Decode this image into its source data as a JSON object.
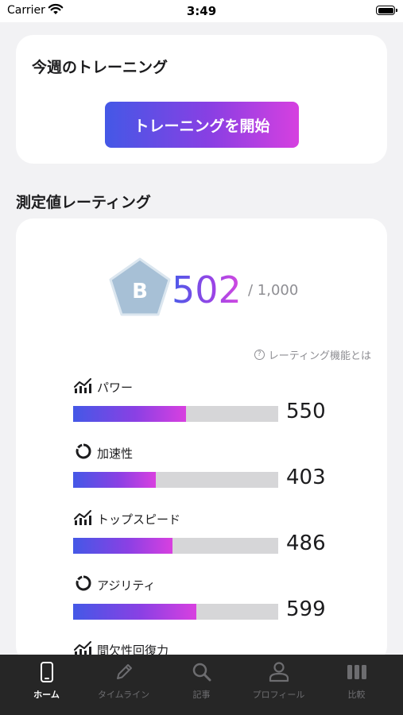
{
  "status_bar": {
    "carrier": "Carrier",
    "time": "3:49"
  },
  "training_card": {
    "title": "今週のトレーニング",
    "start_button": "トレーニングを開始"
  },
  "rating_section": {
    "title": "測定値レーティング",
    "badge_grade": "B",
    "score": "502",
    "score_max": "/ 1,000",
    "help_link": "レーティング機能とは"
  },
  "metrics": [
    {
      "label": "パワー",
      "value": "550",
      "progress": 0.55,
      "icon": "bar-chart-icon"
    },
    {
      "label": "加速性",
      "value": "403",
      "progress": 0.403,
      "icon": "circle-arc-icon"
    },
    {
      "label": "トップスピード",
      "value": "486",
      "progress": 0.486,
      "icon": "bar-chart-icon"
    },
    {
      "label": "アジリティ",
      "value": "599",
      "progress": 0.599,
      "icon": "circle-arc-icon"
    },
    {
      "label": "間欠性回復力",
      "icon": "bar-chart-icon"
    }
  ],
  "tab_bar": {
    "items": [
      {
        "label": "ホーム",
        "icon": "phone-icon",
        "active": true
      },
      {
        "label": "タイムライン",
        "icon": "pencil-icon",
        "active": false
      },
      {
        "label": "記事",
        "icon": "search-icon",
        "active": false
      },
      {
        "label": "プロフィール",
        "icon": "person-icon",
        "active": false
      },
      {
        "label": "比較",
        "icon": "columns-icon",
        "active": false
      }
    ]
  },
  "colors": {
    "accent_start": "#4458e6",
    "accent_end": "#d640e0",
    "badge_fill": "#a7c0d6",
    "tab_bar_bg": "#262626"
  }
}
